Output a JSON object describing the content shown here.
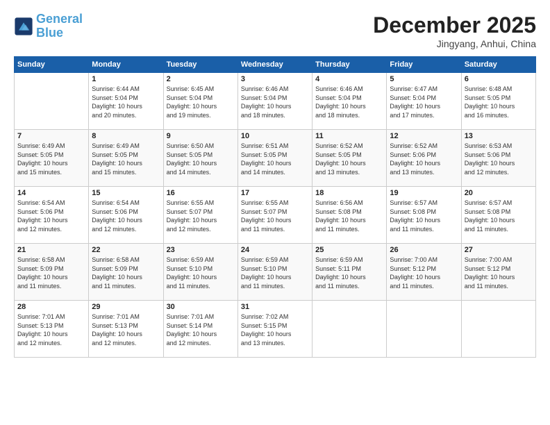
{
  "logo": {
    "line1": "General",
    "line2": "Blue"
  },
  "title": "December 2025",
  "location": "Jingyang, Anhui, China",
  "days_of_week": [
    "Sunday",
    "Monday",
    "Tuesday",
    "Wednesday",
    "Thursday",
    "Friday",
    "Saturday"
  ],
  "weeks": [
    [
      {
        "day": "",
        "info": ""
      },
      {
        "day": "1",
        "info": "Sunrise: 6:44 AM\nSunset: 5:04 PM\nDaylight: 10 hours\nand 20 minutes."
      },
      {
        "day": "2",
        "info": "Sunrise: 6:45 AM\nSunset: 5:04 PM\nDaylight: 10 hours\nand 19 minutes."
      },
      {
        "day": "3",
        "info": "Sunrise: 6:46 AM\nSunset: 5:04 PM\nDaylight: 10 hours\nand 18 minutes."
      },
      {
        "day": "4",
        "info": "Sunrise: 6:46 AM\nSunset: 5:04 PM\nDaylight: 10 hours\nand 18 minutes."
      },
      {
        "day": "5",
        "info": "Sunrise: 6:47 AM\nSunset: 5:04 PM\nDaylight: 10 hours\nand 17 minutes."
      },
      {
        "day": "6",
        "info": "Sunrise: 6:48 AM\nSunset: 5:05 PM\nDaylight: 10 hours\nand 16 minutes."
      }
    ],
    [
      {
        "day": "7",
        "info": "Sunrise: 6:49 AM\nSunset: 5:05 PM\nDaylight: 10 hours\nand 15 minutes."
      },
      {
        "day": "8",
        "info": "Sunrise: 6:49 AM\nSunset: 5:05 PM\nDaylight: 10 hours\nand 15 minutes."
      },
      {
        "day": "9",
        "info": "Sunrise: 6:50 AM\nSunset: 5:05 PM\nDaylight: 10 hours\nand 14 minutes."
      },
      {
        "day": "10",
        "info": "Sunrise: 6:51 AM\nSunset: 5:05 PM\nDaylight: 10 hours\nand 14 minutes."
      },
      {
        "day": "11",
        "info": "Sunrise: 6:52 AM\nSunset: 5:05 PM\nDaylight: 10 hours\nand 13 minutes."
      },
      {
        "day": "12",
        "info": "Sunrise: 6:52 AM\nSunset: 5:06 PM\nDaylight: 10 hours\nand 13 minutes."
      },
      {
        "day": "13",
        "info": "Sunrise: 6:53 AM\nSunset: 5:06 PM\nDaylight: 10 hours\nand 12 minutes."
      }
    ],
    [
      {
        "day": "14",
        "info": "Sunrise: 6:54 AM\nSunset: 5:06 PM\nDaylight: 10 hours\nand 12 minutes."
      },
      {
        "day": "15",
        "info": "Sunrise: 6:54 AM\nSunset: 5:06 PM\nDaylight: 10 hours\nand 12 minutes."
      },
      {
        "day": "16",
        "info": "Sunrise: 6:55 AM\nSunset: 5:07 PM\nDaylight: 10 hours\nand 12 minutes."
      },
      {
        "day": "17",
        "info": "Sunrise: 6:55 AM\nSunset: 5:07 PM\nDaylight: 10 hours\nand 11 minutes."
      },
      {
        "day": "18",
        "info": "Sunrise: 6:56 AM\nSunset: 5:08 PM\nDaylight: 10 hours\nand 11 minutes."
      },
      {
        "day": "19",
        "info": "Sunrise: 6:57 AM\nSunset: 5:08 PM\nDaylight: 10 hours\nand 11 minutes."
      },
      {
        "day": "20",
        "info": "Sunrise: 6:57 AM\nSunset: 5:08 PM\nDaylight: 10 hours\nand 11 minutes."
      }
    ],
    [
      {
        "day": "21",
        "info": "Sunrise: 6:58 AM\nSunset: 5:09 PM\nDaylight: 10 hours\nand 11 minutes."
      },
      {
        "day": "22",
        "info": "Sunrise: 6:58 AM\nSunset: 5:09 PM\nDaylight: 10 hours\nand 11 minutes."
      },
      {
        "day": "23",
        "info": "Sunrise: 6:59 AM\nSunset: 5:10 PM\nDaylight: 10 hours\nand 11 minutes."
      },
      {
        "day": "24",
        "info": "Sunrise: 6:59 AM\nSunset: 5:10 PM\nDaylight: 10 hours\nand 11 minutes."
      },
      {
        "day": "25",
        "info": "Sunrise: 6:59 AM\nSunset: 5:11 PM\nDaylight: 10 hours\nand 11 minutes."
      },
      {
        "day": "26",
        "info": "Sunrise: 7:00 AM\nSunset: 5:12 PM\nDaylight: 10 hours\nand 11 minutes."
      },
      {
        "day": "27",
        "info": "Sunrise: 7:00 AM\nSunset: 5:12 PM\nDaylight: 10 hours\nand 11 minutes."
      }
    ],
    [
      {
        "day": "28",
        "info": "Sunrise: 7:01 AM\nSunset: 5:13 PM\nDaylight: 10 hours\nand 12 minutes."
      },
      {
        "day": "29",
        "info": "Sunrise: 7:01 AM\nSunset: 5:13 PM\nDaylight: 10 hours\nand 12 minutes."
      },
      {
        "day": "30",
        "info": "Sunrise: 7:01 AM\nSunset: 5:14 PM\nDaylight: 10 hours\nand 12 minutes."
      },
      {
        "day": "31",
        "info": "Sunrise: 7:02 AM\nSunset: 5:15 PM\nDaylight: 10 hours\nand 13 minutes."
      },
      {
        "day": "",
        "info": ""
      },
      {
        "day": "",
        "info": ""
      },
      {
        "day": "",
        "info": ""
      }
    ]
  ]
}
